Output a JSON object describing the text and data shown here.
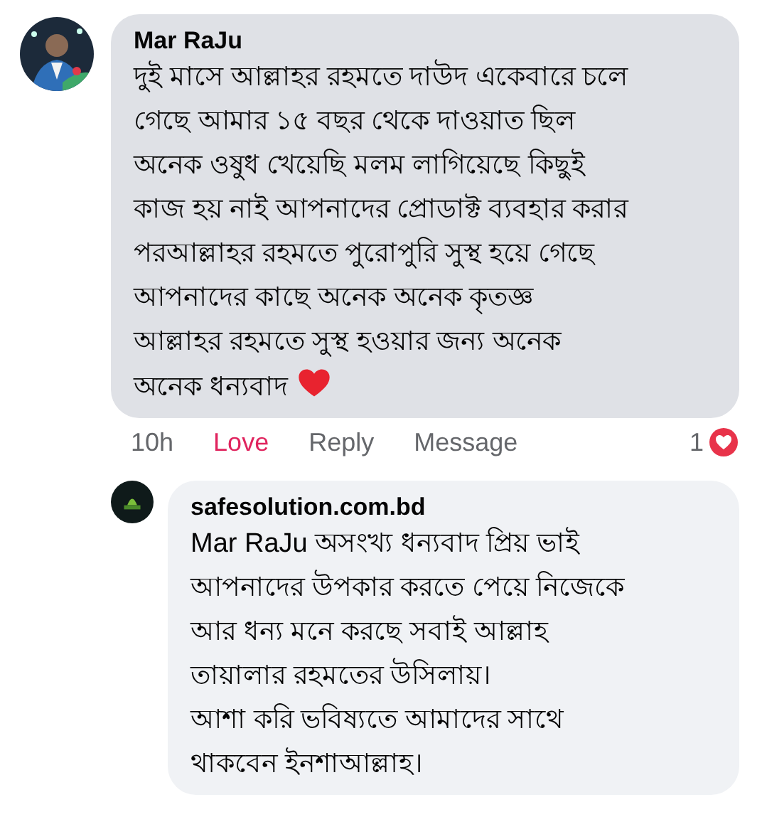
{
  "comments": [
    {
      "author": "Mar RaJu",
      "lines": [
        "দুই মাসে আল্লাহর রহমতে দাউদ একেবারে চলে",
        "গেছে আমার ১৫ বছর থেকে দাওয়াত ছিল",
        "অনেক ওষুধ খেয়েছি মলম লাগিয়েছে কিছুই",
        "কাজ হয় নাই আপনাদের প্রোডাক্ট ব্যবহার করার",
        "পরআল্লাহর রহমতে পুরোপুরি সুস্থ হয়ে গেছে",
        "আপনাদের কাছে অনেক অনেক কৃতজ্ঞ",
        "আল্লাহর রহমতে সুস্থ হওয়ার জন্য অনেক",
        "অনেক ধন্যবাদ"
      ],
      "ends_with_heart": true,
      "actions": {
        "time": "10h",
        "reaction": {
          "label": "Love",
          "reacted": true
        },
        "reply": "Reply",
        "message": "Message",
        "reaction_count": "1"
      },
      "replies": [
        {
          "author": "safesolution.com.bd",
          "lines": [
            "Mar RaJu অসংখ্য ধন্যবাদ প্রিয় ভাই",
            "আপনাদের উপকার করতে পেয়ে নিজেকে",
            "আর ধন্য মনে করছে সবাই আল্লাহ",
            "তায়ালার রহমতের উসিলায়।",
            "আশা করি ভবিষ্যতে আমাদের সাথে",
            "থাকবেন ইনশাআল্লাহ।"
          ]
        }
      ]
    }
  ]
}
